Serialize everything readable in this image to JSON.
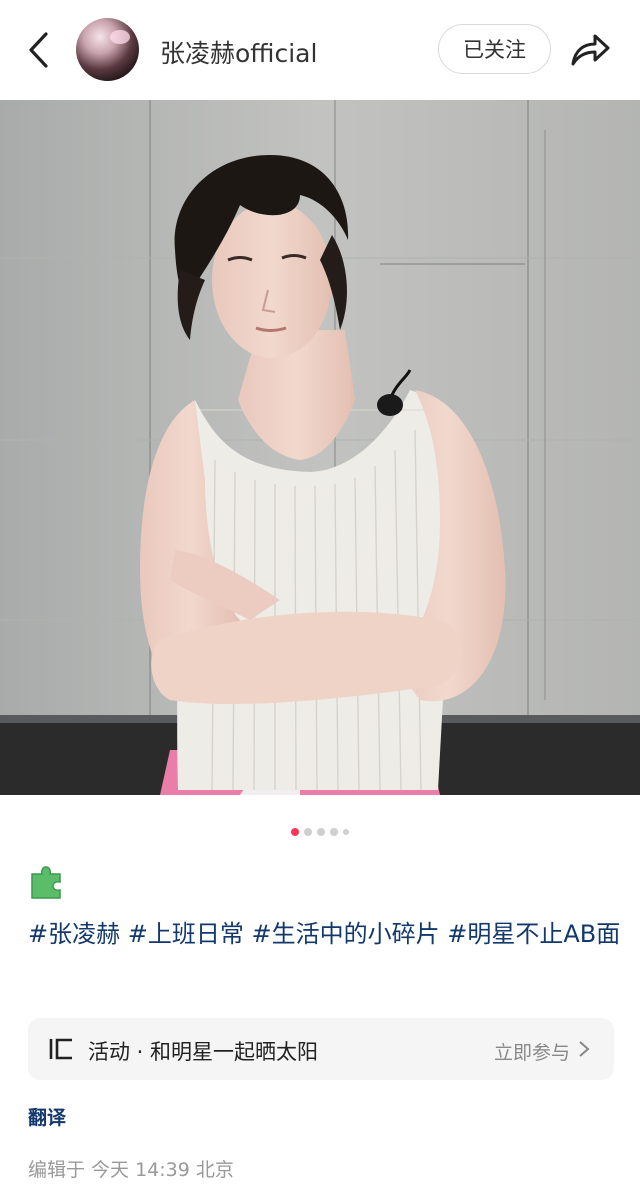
{
  "header": {
    "username": "张凌赫official",
    "follow_label": "已关注",
    "back_icon": "back-arrow-icon",
    "share_icon": "share-arrow-icon"
  },
  "post": {
    "image_description_icon": "photo",
    "page_count": 5,
    "active_page": 1,
    "emoji_icon": "puzzle-piece-icon",
    "hashtags": [
      "#张凌赫",
      "#上班日常",
      "#生活中的小碎片",
      "#明星不止AB面"
    ]
  },
  "activity": {
    "icon": "activity-bracket-icon",
    "label": "活动 · 和明星一起晒太阳",
    "join_label": "立即参与"
  },
  "footer": {
    "translate_label": "翻译",
    "edited_prefix": "编辑于",
    "time": "今天 14:39",
    "location": "北京"
  },
  "colors": {
    "accent": "#ff3355",
    "hashtag": "#13386c",
    "muted": "#999999"
  }
}
